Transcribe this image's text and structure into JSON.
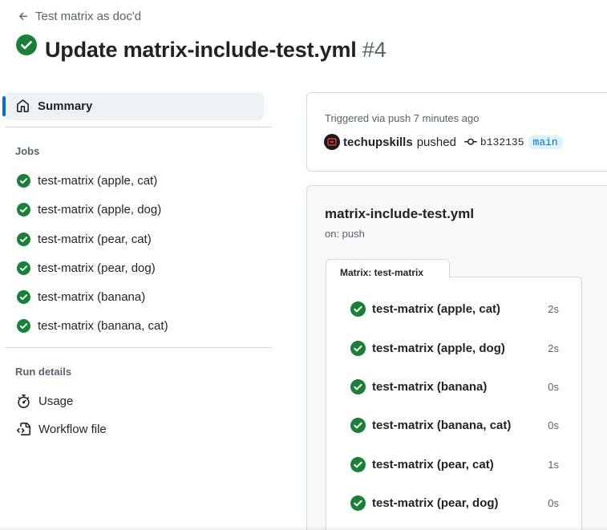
{
  "header": {
    "back_label": "Test matrix as doc'd",
    "title": "Update matrix-include-test.yml",
    "run_number": "#4"
  },
  "sidebar": {
    "summary_label": "Summary",
    "jobs_label": "Jobs",
    "jobs": [
      {
        "label": "test-matrix (apple, cat)"
      },
      {
        "label": "test-matrix (apple, dog)"
      },
      {
        "label": "test-matrix (pear, cat)"
      },
      {
        "label": "test-matrix (pear, dog)"
      },
      {
        "label": "test-matrix (banana)"
      },
      {
        "label": "test-matrix (banana, cat)"
      }
    ],
    "run_details_label": "Run details",
    "usage_label": "Usage",
    "workflow_file_label": "Workflow file"
  },
  "trigger": {
    "text": "Triggered via push 7 minutes ago",
    "actor": "techupskills",
    "action": "pushed",
    "commit_sha": "b132135",
    "branch": "main"
  },
  "workflow": {
    "name": "matrix-include-test.yml",
    "on": "on: push",
    "matrix_label": "Matrix: test-matrix",
    "jobs": [
      {
        "label": "test-matrix (apple, cat)",
        "duration": "2s"
      },
      {
        "label": "test-matrix (apple, dog)",
        "duration": "2s"
      },
      {
        "label": "test-matrix (banana)",
        "duration": "0s"
      },
      {
        "label": "test-matrix (banana, cat)",
        "duration": "0s"
      },
      {
        "label": "test-matrix (pear, cat)",
        "duration": "1s"
      },
      {
        "label": "test-matrix (pear, dog)",
        "duration": "0s"
      }
    ]
  },
  "colors": {
    "success": "#1a7f37",
    "accent": "#0969da",
    "muted": "#59636e",
    "border": "#d1d9e0"
  }
}
